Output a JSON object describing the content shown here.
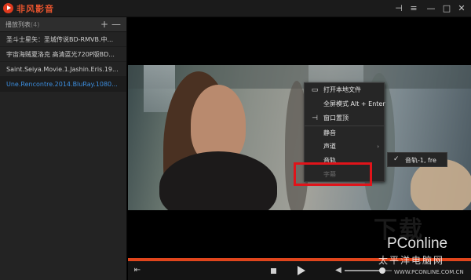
{
  "app": {
    "title": "非风影音"
  },
  "window_controls": {
    "pin": "⊣",
    "menu": "≡",
    "minimize": "—",
    "maximize": "□",
    "close": "✕"
  },
  "playlist": {
    "title": "播放列表",
    "count": "(4)",
    "add": "+",
    "remove": "—",
    "items": [
      "圣斗士星矢：圣城传说BD-RMVB.中...",
      "宇宙海贼夏洛克 高清蓝光720P版BD...",
      "Saint.Seiya.Movie.1.Jashin.Eris.19...",
      "Une.Rencontre.2014.BluRay.1080..."
    ],
    "active_index": 3
  },
  "context_menu": {
    "items": [
      {
        "label": "打开本地文件",
        "icon": "▭"
      },
      {
        "label": "全屏模式 Alt + Enter",
        "icon": ""
      },
      {
        "label": "窗口置顶",
        "icon": "⊣"
      },
      {
        "label": "静音",
        "icon": ""
      },
      {
        "label": "声道",
        "icon": "",
        "arrow": "›"
      },
      {
        "label": "音轨",
        "icon": ""
      },
      {
        "label": "字幕",
        "icon": "",
        "disabled": true
      }
    ]
  },
  "submenu": {
    "check": "✓",
    "label": "音轨-1, fre"
  },
  "playback": {
    "progress_percent": 100,
    "volume_percent": 80
  },
  "watermark": {
    "big": "下载",
    "brand": "PConline",
    "sub": "太平洋电脑网",
    "small": "WWW.PCONLINE.COM.CN"
  },
  "colors": {
    "accent": "#e0451c",
    "active_item": "#3d8fe0",
    "highlight_box": "#e0141a"
  }
}
